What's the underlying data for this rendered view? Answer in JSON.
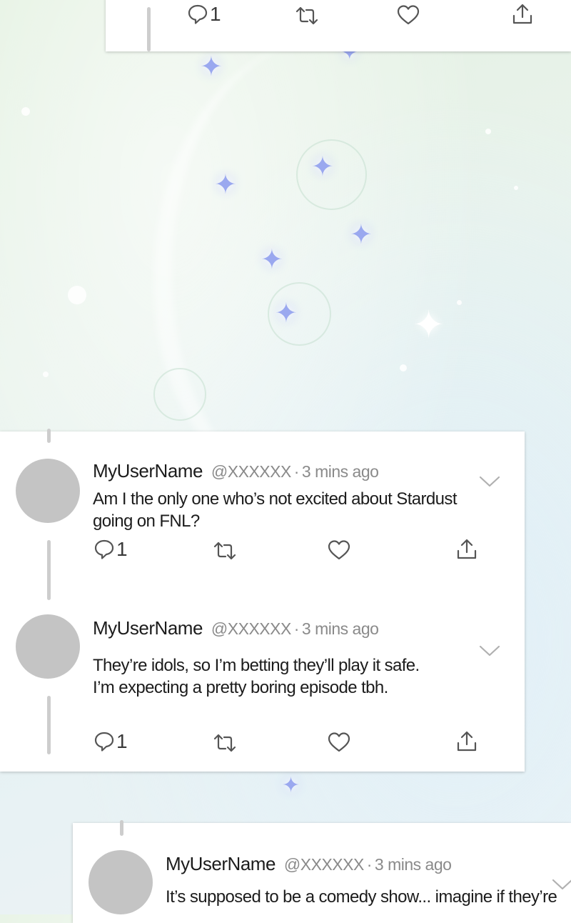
{
  "tweets": [
    {
      "user": "",
      "handle": "",
      "dot": "",
      "time": "",
      "lines": [],
      "reply_count": "1"
    },
    {
      "user": "MyUserName",
      "handle": "@XXXXXX",
      "dot": "·",
      "time": "3 mins ago",
      "lines": [
        "Am I the only one who’s not excited about Stardust",
        "going on FNL?"
      ],
      "reply_count": "1"
    },
    {
      "user": "MyUserName",
      "handle": "@XXXXXX",
      "dot": "·",
      "time": "3 mins ago",
      "lines": [
        "They’re idols, so I’m betting they’ll play it safe.",
        "I’m expecting a pretty boring episode tbh."
      ],
      "reply_count": "1"
    },
    {
      "user": "MyUserName",
      "handle": "@XXXXXX",
      "dot": "·",
      "time": "3 mins ago",
      "lines": [
        "It’s supposed to be a comedy show... imagine if they’re"
      ],
      "reply_count": ""
    }
  ],
  "icons": {
    "reply": "reply-icon",
    "retweet": "retweet-icon",
    "like": "heart-icon",
    "share": "share-icon",
    "menu": "chevron-down-icon"
  },
  "colors": {
    "card": "#ffffff",
    "avatar": "#c4c4c4",
    "thread_line": "#cdcdcd",
    "handle_text": "#8a8a8a",
    "star": "#9aa8ef"
  }
}
